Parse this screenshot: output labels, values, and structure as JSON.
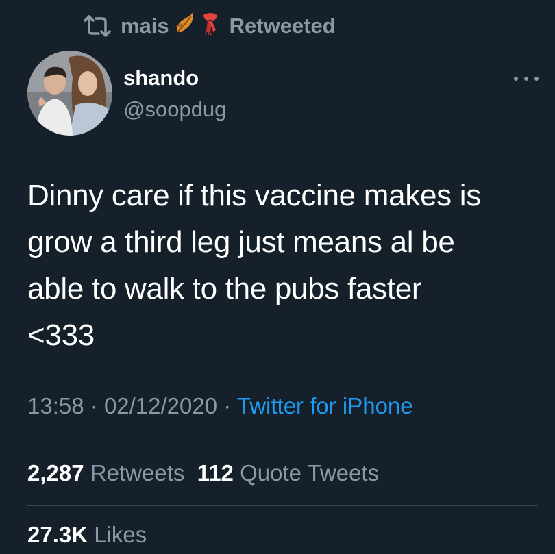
{
  "retweet_header": {
    "retweeter": "mais",
    "status": "Retweeted"
  },
  "author": {
    "name": "shando",
    "handle": "@soopdug"
  },
  "tweet": {
    "text": "Dinny care if this vaccine makes is\ngrow a third leg just means al be\nable to walk to the pubs faster\n<333",
    "time": "13:58",
    "separator": "·",
    "date": "02/12/2020",
    "source": "Twitter for iPhone"
  },
  "stats": {
    "retweets": "2,287",
    "retweets_label": "Retweets",
    "quotes": "112",
    "quotes_label": "Quote Tweets",
    "likes": "27.3K",
    "likes_label": "Likes"
  },
  "colors": {
    "background": "#15202b",
    "text": "#ffffff",
    "muted": "#8b98a5",
    "link": "#1d9bf0",
    "divider": "#38444d"
  },
  "icons": {
    "retweet": "retweet-icon",
    "leaf": "fallen-leaf-emoji",
    "scarf": "scarf-emoji",
    "more": "more-icon"
  }
}
